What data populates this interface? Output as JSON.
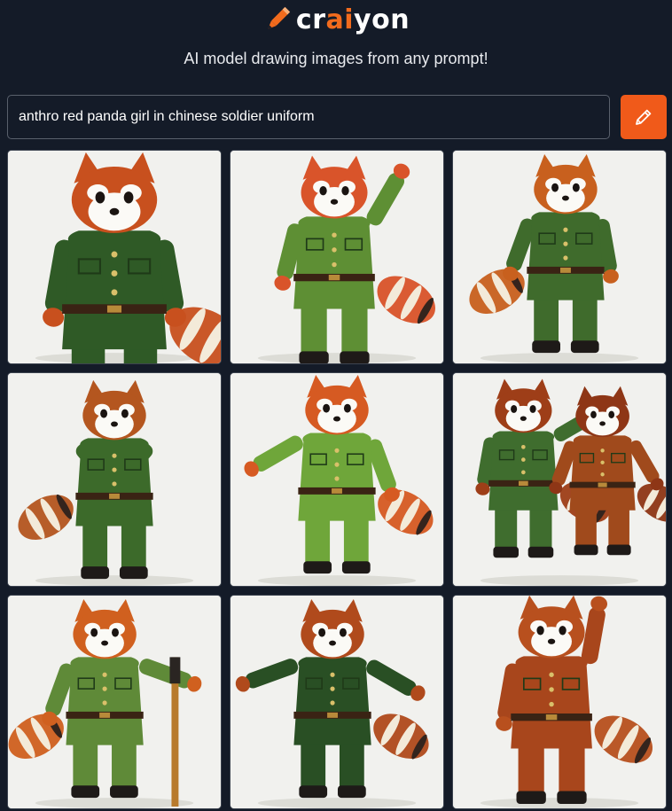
{
  "brand": {
    "prefix": "cr",
    "ai": "ai",
    "suffix": "yon",
    "accent_color": "#f26b1d",
    "icon": "pencil-icon"
  },
  "tagline": "AI model drawing images from any prompt!",
  "prompt": {
    "value": "anthro red panda girl in chinese soldier uniform",
    "button_icon": "pencil-icon"
  },
  "images": [
    {
      "fur": "#c8501e",
      "uniform": "#2f5a26",
      "pose": "portrait"
    },
    {
      "fur": "#d9542a",
      "uniform": "#5e8f34",
      "pose": "wave"
    },
    {
      "fur": "#c8601e",
      "uniform": "#3f6b2c",
      "pose": "tail"
    },
    {
      "fur": "#b4561f",
      "uniform": "#3c6a2a",
      "pose": "hips"
    },
    {
      "fur": "#d65a22",
      "uniform": "#6fa63a",
      "pose": "fist"
    },
    {
      "fur": "#9e3e18",
      "uniform": "#3f6d2e",
      "pose": "pair"
    },
    {
      "fur": "#d0601f",
      "uniform": "#5f8a38",
      "pose": "staff"
    },
    {
      "fur": "#b04a1c",
      "uniform": "#294f24",
      "pose": "dance"
    },
    {
      "fur": "#b8501e",
      "uniform": "#a8461c",
      "pose": "salute"
    }
  ]
}
